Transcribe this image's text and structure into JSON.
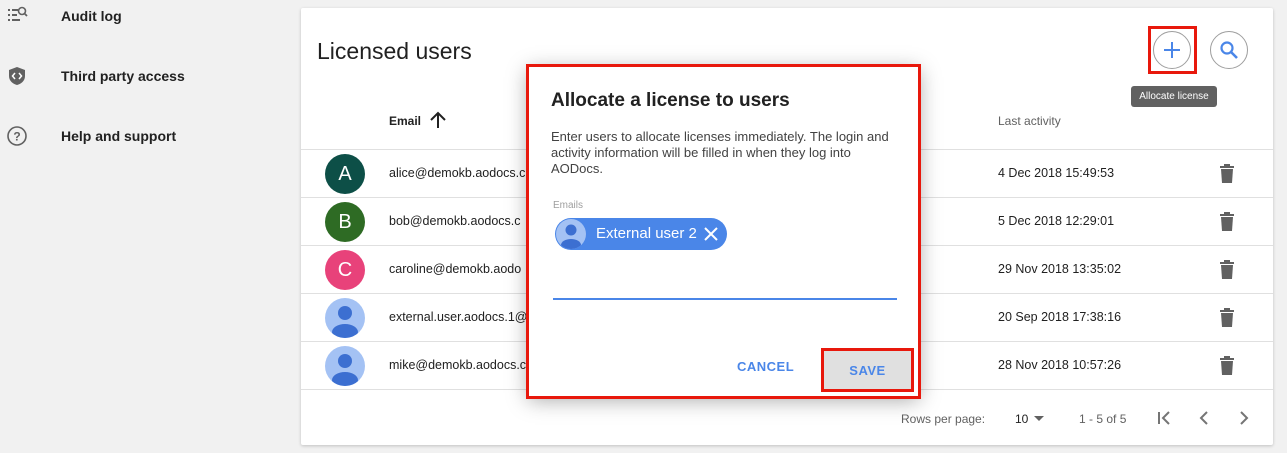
{
  "sidebar": {
    "items": [
      {
        "label": "Audit log",
        "icon": "audit-log-icon"
      },
      {
        "label": "Third party access",
        "icon": "shield-code-icon"
      },
      {
        "label": "Help and support",
        "icon": "help-circle-icon"
      }
    ]
  },
  "main": {
    "title": "Licensed users",
    "add_tooltip": "Allocate license",
    "columns": {
      "email": "Email",
      "last_activity": "Last activity"
    },
    "rows": [
      {
        "initial": "A",
        "avatar_color": "#0d4f47",
        "email": "alice@demokb.aodocs.c",
        "last_activity": "4 Dec 2018 15:49:53"
      },
      {
        "initial": "B",
        "avatar_color": "#2e6b24",
        "email": "bob@demokb.aodocs.c",
        "last_activity": "5 Dec 2018 12:29:01"
      },
      {
        "initial": "C",
        "avatar_color": "#e8427a",
        "email": "caroline@demokb.aodo",
        "last_activity": "29 Nov 2018 13:35:02"
      },
      {
        "initial": "",
        "avatar_color": "#a4c2f4",
        "email": "external.user.aodocs.1@",
        "last_activity": "20 Sep 2018 17:38:16"
      },
      {
        "initial": "",
        "avatar_color": "#a4c2f4",
        "email": "mike@demokb.aodocs.c",
        "last_activity": "28 Nov 2018 10:57:26"
      }
    ],
    "footer": {
      "rows_per_page_label": "Rows per page:",
      "rows_per_page": "10",
      "range": "1 - 5 of 5"
    }
  },
  "dialog": {
    "title": "Allocate a license to users",
    "description": "Enter users to allocate licenses immediately. The login and activity information will be filled in when they log into AODocs.",
    "field_label": "Emails",
    "chip_label": "External user 2",
    "cancel_label": "CANCEL",
    "save_label": "SAVE"
  },
  "colors": {
    "accent": "#4a86e8",
    "highlight": "#e8180c"
  }
}
